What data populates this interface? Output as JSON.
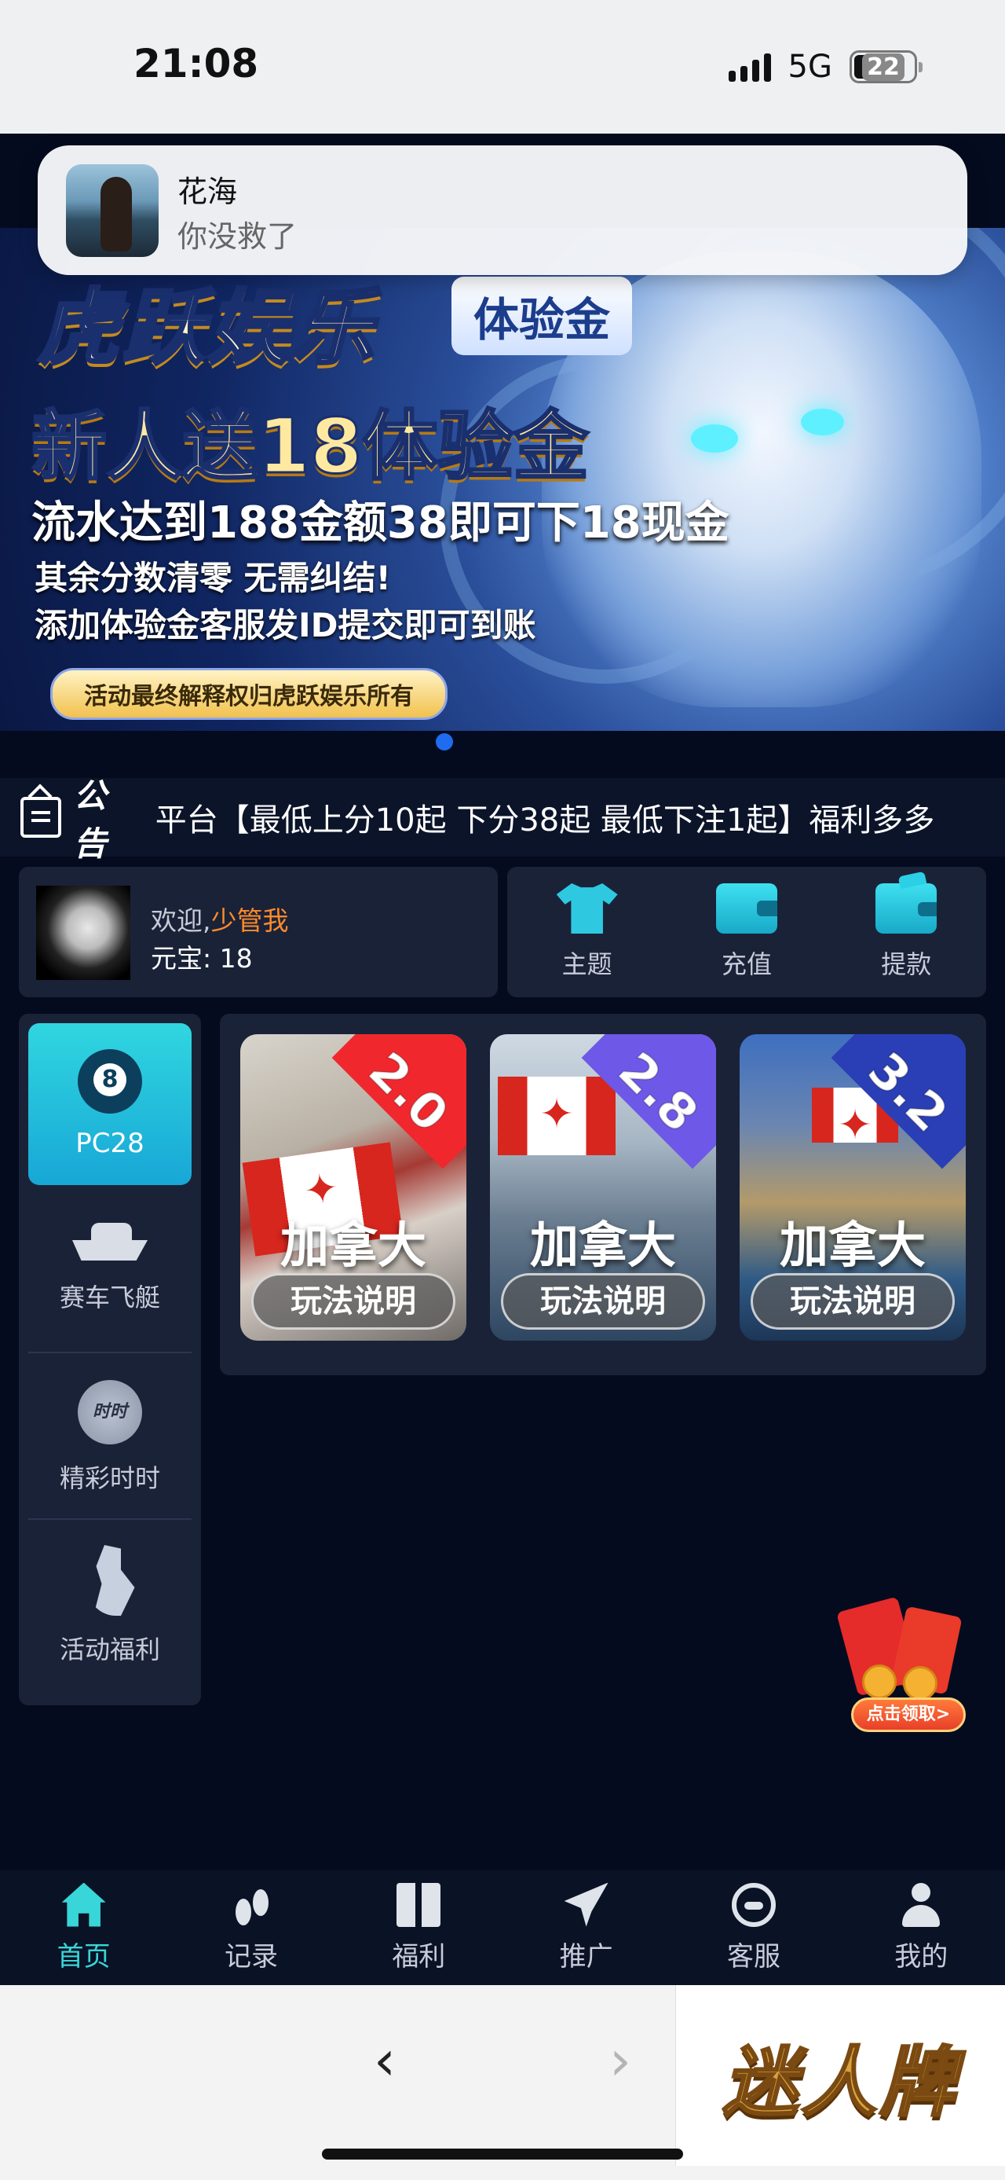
{
  "status_bar": {
    "time": "21:08",
    "network": "5G",
    "battery": "22"
  },
  "notification": {
    "title": "花海",
    "message": "你没救了"
  },
  "banner": {
    "brand": "虎跃娱乐",
    "tag": "体验金",
    "headline": "新人送18体验金",
    "line2": "流水达到188金额38即可下18现金",
    "line3": "其余分数清零 无需纠结!",
    "line4": "添加体验金客服发ID提交即可到账",
    "footer": "活动最终解释权归虎跃娱乐所有"
  },
  "notice": {
    "label": "公告",
    "text": "平台【最低上分10起 下分38起 最低下注1起】福利多多"
  },
  "user": {
    "welcome": "欢迎,",
    "name": "少管我",
    "coins_label": "元宝:",
    "coins": "18"
  },
  "actions": [
    {
      "label": "主题",
      "icon": "shirt-icon"
    },
    {
      "label": "充值",
      "icon": "wallet-icon"
    },
    {
      "label": "提款",
      "icon": "withdraw-icon"
    }
  ],
  "left_nav": [
    {
      "label": "PC28",
      "icon": "pool-ball-icon",
      "ball": "8",
      "active": true
    },
    {
      "label": "赛车飞艇",
      "icon": "boat-icon"
    },
    {
      "label": "精彩时时",
      "icon": "clock-icon",
      "badge": "时时"
    },
    {
      "label": "活动福利",
      "icon": "girl-icon"
    }
  ],
  "games": [
    {
      "name": "加拿大",
      "odds": "2.0",
      "button": "玩法说明",
      "ribbon_color": "#f0282e"
    },
    {
      "name": "加拿大",
      "odds": "2.8",
      "button": "玩法说明",
      "ribbon_color": "#6e58e8"
    },
    {
      "name": "加拿大",
      "odds": "3.2",
      "button": "玩法说明",
      "ribbon_color": "#2a3fb5"
    }
  ],
  "red_envelope": {
    "button": "点击领取>"
  },
  "tabs": [
    {
      "label": "首页",
      "icon": "home-icon",
      "active": true
    },
    {
      "label": "记录",
      "icon": "footprint-icon"
    },
    {
      "label": "福利",
      "icon": "gift-icon"
    },
    {
      "label": "推广",
      "icon": "paper-plane-icon"
    },
    {
      "label": "客服",
      "icon": "headset-icon"
    },
    {
      "label": "我的",
      "icon": "user-icon"
    }
  ],
  "browser": {
    "back": "‹",
    "forward": "›",
    "ad_text": "迷人牌"
  }
}
